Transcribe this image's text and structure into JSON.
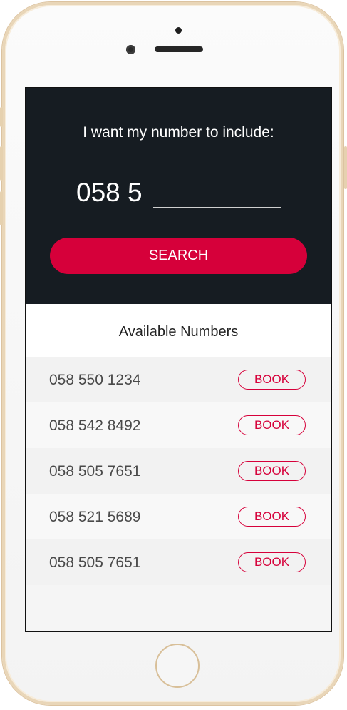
{
  "search": {
    "prompt": "I want my number to include:",
    "prefix": "058 5",
    "input_value": "",
    "button_label": "SEARCH"
  },
  "results": {
    "header": "Available Numbers",
    "items": [
      {
        "number": "058 550 1234",
        "action_label": "BOOK"
      },
      {
        "number": "058 542 8492",
        "action_label": "BOOK"
      },
      {
        "number": "058 505 7651",
        "action_label": "BOOK"
      },
      {
        "number": "058 521 5689",
        "action_label": "BOOK"
      },
      {
        "number": "058 505 7651",
        "action_label": "BOOK"
      }
    ]
  },
  "colors": {
    "accent": "#d6003a",
    "panel_bg": "#161c22",
    "phone_frame": "#e9d6b8"
  }
}
